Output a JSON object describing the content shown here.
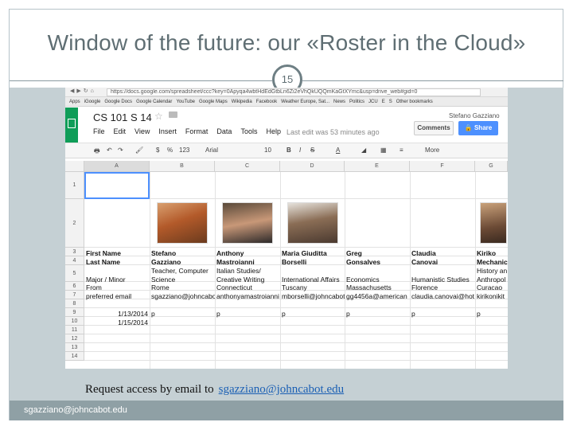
{
  "slide": {
    "title": "Window of the future: our «Roster in the Cloud»",
    "page_number": "15",
    "request_text": "Request access by email to",
    "request_email": "sgazziano@johncabot.edu",
    "footer": "sgazziano@johncabot.edu"
  },
  "browser": {
    "url": "https://docs.google.com/spreadsheet/ccc?key=0Apyqa4wbtHdEdGtbLn6Zi2eVhQkUQQmKaGtXYmc&usp=drive_web#gid=0",
    "bookmarks": [
      "Apps",
      "iGoogle",
      "Google Docs",
      "Google Calendar",
      "YouTube",
      "Google Maps",
      "Wikipedia",
      "Facebook",
      "Weather Europe, Sat...",
      "News",
      "Politics",
      "JCU",
      "E",
      "S",
      "Other bookmarks"
    ]
  },
  "doc": {
    "title": "CS 101 S 14",
    "menu": [
      "File",
      "Edit",
      "View",
      "Insert",
      "Format",
      "Data",
      "Tools",
      "Help"
    ],
    "last_edit": "Last edit was 53 minutes ago",
    "user": "Stefano Gazziano",
    "comments_label": "Comments",
    "share_label": "Share",
    "toolbar": {
      "currency": "$",
      "percent": "%",
      "number_format": "123",
      "font": "Arial",
      "font_size": "10",
      "bold": "B",
      "italic": "I",
      "strike": "S",
      "text_color": "A",
      "more": "More"
    }
  },
  "sheet": {
    "columns": [
      "A",
      "B",
      "C",
      "D",
      "E",
      "F",
      "G"
    ],
    "rows": [
      "1",
      "2",
      "3",
      "4",
      "5",
      "6",
      "7",
      "8",
      "9",
      "10",
      "11",
      "12",
      "13",
      "14"
    ],
    "row3": [
      "First Name",
      "Stefano",
      "Anthony",
      "Maria Giuditta",
      "Greg",
      "Claudia",
      "Kiriko"
    ],
    "row4": [
      "Last Name",
      "Gazziano",
      "Mastroianni",
      "Borselli",
      "Gonsalves",
      "Canovai",
      "Mechanic"
    ],
    "row5a": [
      "",
      "Teacher, Computer",
      "Italian Studies/",
      "",
      "",
      "",
      "History an"
    ],
    "row5b": [
      "Major / Minor",
      "Science",
      "Creative Writing",
      "International Affairs",
      "Economics",
      "Humanistic Studies",
      "Anthropol"
    ],
    "row6": [
      "From",
      "Rome",
      "Connecticut",
      "Tuscany",
      "Massachusetts",
      "Florence",
      "Curacao"
    ],
    "row7": [
      "preferred email",
      "sgazziano@johncabot",
      "anthonyamastroianni",
      "mborselli@johncabot",
      "gg4456a@american",
      "claudia.canovai@hot",
      "kirikonikit"
    ],
    "row9": [
      "1/13/2014",
      "p",
      "p",
      "p",
      "p",
      "p",
      "p"
    ],
    "row10": [
      "1/15/2014",
      "",
      "",
      "",
      "",
      "",
      ""
    ]
  }
}
